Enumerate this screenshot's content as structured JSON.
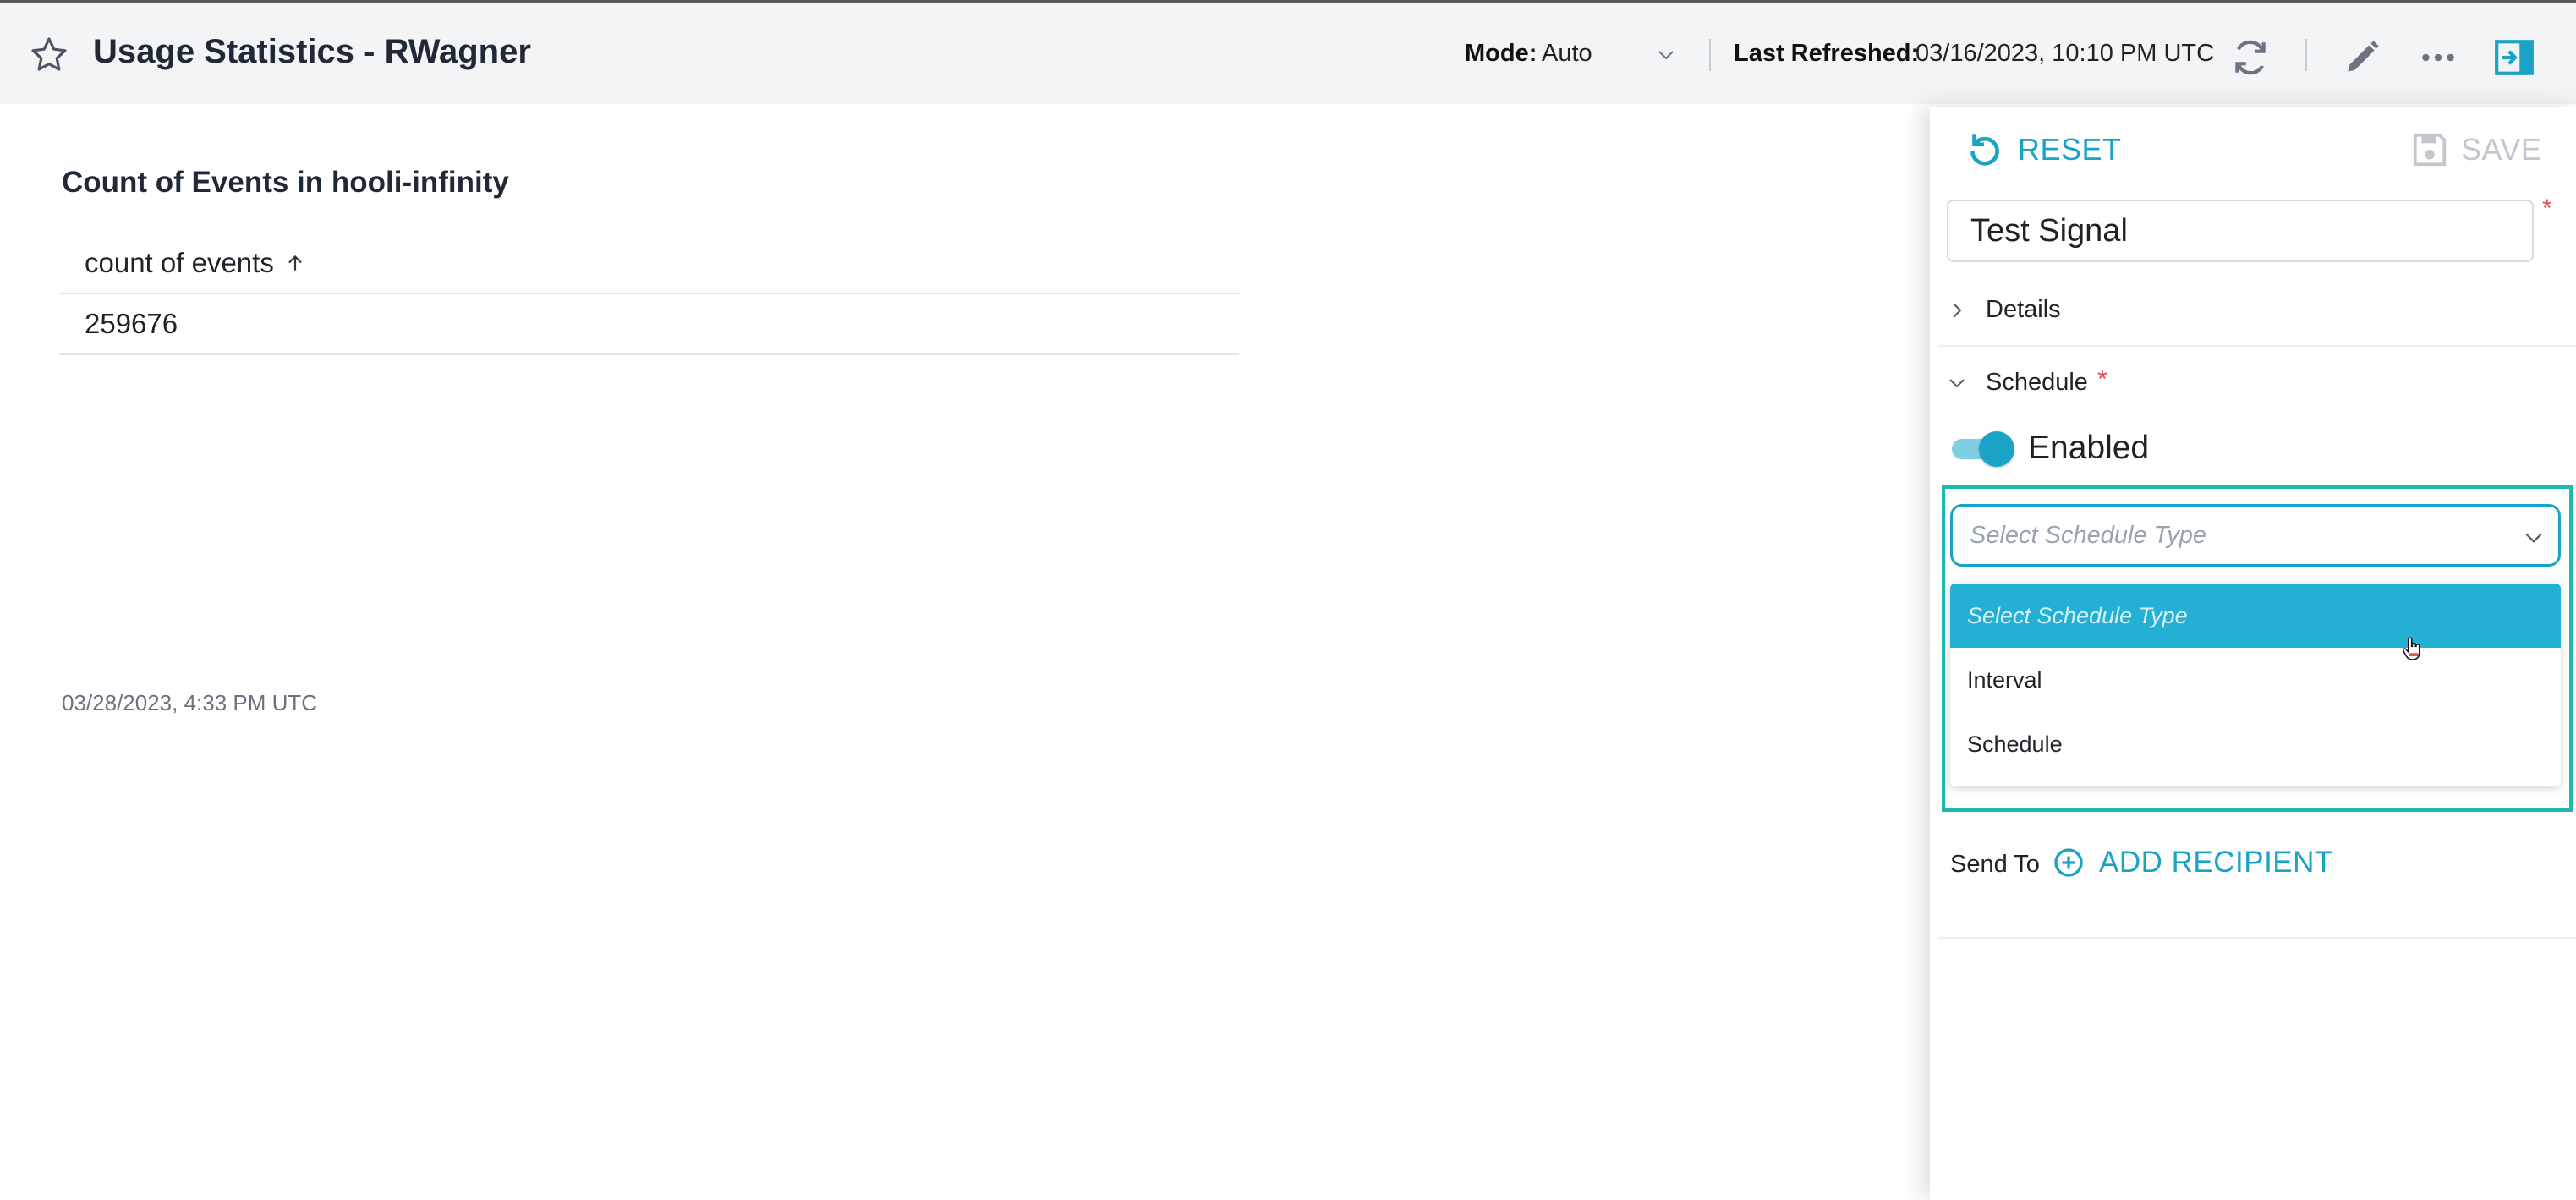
{
  "header": {
    "title": "Usage Statistics - RWagner",
    "mode_label": "Mode:",
    "mode_value": "Auto",
    "last_refreshed_label": "Last Refreshed:",
    "last_refreshed_value": "03/16/2023, 10:10 PM UTC",
    "icons": [
      "star-icon",
      "chevron-down-icon",
      "refresh-icon",
      "pencil-icon",
      "more-icon",
      "panel-toggle-icon"
    ]
  },
  "widget": {
    "title": "Count of Events in hooli-infinity",
    "column_header": "count of events",
    "rows": [
      "259676"
    ],
    "timestamp": "03/28/2023, 4:33 PM UTC"
  },
  "panel": {
    "reset_label": "RESET",
    "save_label": "SAVE",
    "name_value": "Test Signal",
    "required_mark": "*",
    "details_label": "Details",
    "schedule_label": "Schedule",
    "enabled_label": "Enabled",
    "enabled": true,
    "schedule_type_placeholder": "Select Schedule Type",
    "schedule_type_options": [
      "Select Schedule Type",
      "Interval",
      "Schedule"
    ],
    "send_to_label": "Send To",
    "add_recipient_label": "ADD RECIPIENT"
  },
  "colors": {
    "accent": "#1ba3c6",
    "highlight_border": "#1fb8b0",
    "active_option": "#24b0d4",
    "header_bg": "#f3f4f6"
  }
}
